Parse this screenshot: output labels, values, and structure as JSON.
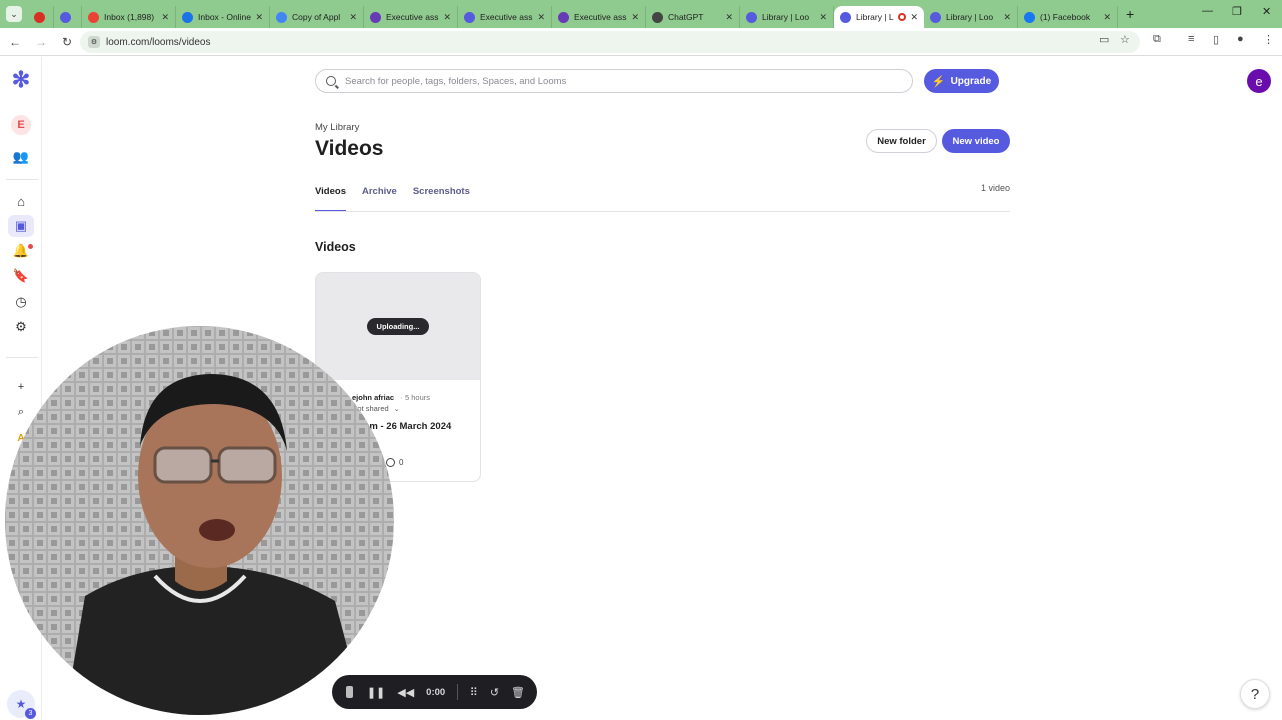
{
  "browser": {
    "tabs": [
      {
        "title": "",
        "icon": "record-icon",
        "color": "#d93025"
      },
      {
        "title": "",
        "icon": "loom-icon",
        "color": "#565adf"
      },
      {
        "title": "Inbox (1,898)",
        "icon": "gmail-icon",
        "color": "#ea4335"
      },
      {
        "title": "Inbox - Online",
        "icon": "app-icon",
        "color": "#1a73e8"
      },
      {
        "title": "Copy of Appl",
        "icon": "docs-icon",
        "color": "#4285f4"
      },
      {
        "title": "Executive ass",
        "icon": "forms-icon",
        "color": "#673ab7"
      },
      {
        "title": "Executive ass",
        "icon": "loom-icon",
        "color": "#565adf"
      },
      {
        "title": "Executive ass",
        "icon": "forms-icon",
        "color": "#673ab7"
      },
      {
        "title": "ChatGPT",
        "icon": "chatgpt-icon",
        "color": "#444444"
      },
      {
        "title": "Library | Loo",
        "icon": "loom-icon",
        "color": "#565adf"
      },
      {
        "title": "Library | L",
        "icon": "loom-icon",
        "color": "#565adf",
        "active": true
      },
      {
        "title": "Library | Loo",
        "icon": "loom-icon",
        "color": "#565adf"
      },
      {
        "title": "(1) Facebook",
        "icon": "facebook-icon",
        "color": "#1877f2"
      }
    ],
    "url": "loom.com/looms/videos"
  },
  "rail": {
    "workspace_initial": "E"
  },
  "header": {
    "search_placeholder": "Search for people, tags, folders, Spaces, and Looms",
    "upgrade_label": "Upgrade",
    "avatar_initial": "e"
  },
  "page": {
    "breadcrumb": "My Library",
    "title": "Videos",
    "new_folder_label": "New folder",
    "new_video_label": "New video",
    "tabs": [
      "Videos",
      "Archive",
      "Screenshots"
    ],
    "count": "1 video",
    "section_title": "Videos"
  },
  "card": {
    "status": "Uploading...",
    "owner": "ejohn afriac",
    "separator": "·",
    "age": "5 hours",
    "shared": "Not shared",
    "title": "Loom - 26 March 2024",
    "comments": "0"
  },
  "recorder": {
    "time": "0:00"
  },
  "help_label": "?",
  "badge_count": "3",
  "colors": {
    "accent": "#565adf",
    "tabstrip": "#8fcb8f"
  }
}
